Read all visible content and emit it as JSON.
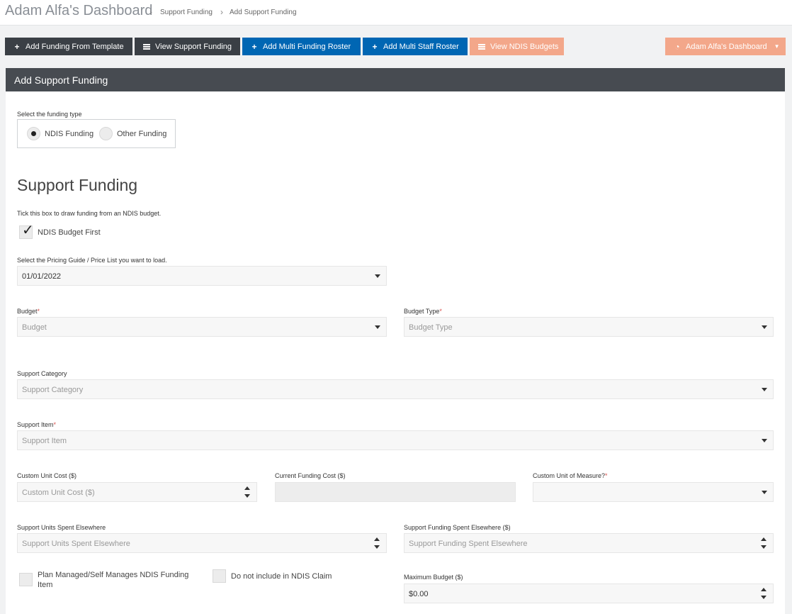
{
  "header": {
    "title": "Adam Alfa's Dashboard",
    "breadcrumbs": [
      "Support Funding",
      "Add Support Funding"
    ]
  },
  "toolbar": {
    "add_template": "Add Funding From Template",
    "view_support": "View Support Funding",
    "add_multi_funding": "Add Multi Funding Roster",
    "add_multi_staff": "Add Multi Staff Roster",
    "view_ndis": "View NDIS Budgets",
    "dashboard_menu": "Adam Alfa's Dashboard"
  },
  "panel": {
    "title": "Add Support Funding",
    "funding_type_label": "Select the funding type",
    "funding_types": [
      "NDIS Funding",
      "Other Funding"
    ],
    "selected_funding_type": "NDIS Funding"
  },
  "form": {
    "section_title": "Support Funding",
    "tick_hint": "Tick this box to draw funding from an NDIS budget.",
    "ndis_budget_first": {
      "label": "NDIS Budget First",
      "checked": true
    },
    "pricing_label": "Select the Pricing Guide / Price List you want to load.",
    "pricing_value": "01/01/2022",
    "budget_label": "Budget",
    "budget_placeholder": "Budget",
    "budget_type_label": "Budget Type",
    "budget_type_placeholder": "Budget Type",
    "support_category_label": "Support Category",
    "support_category_placeholder": "Support Category",
    "support_item_label": "Support Item",
    "support_item_placeholder": "Support Item",
    "custom_unit_cost_label": "Custom Unit Cost ($)",
    "custom_unit_cost_placeholder": "Custom Unit Cost ($)",
    "current_funding_cost_label": "Current Funding Cost ($)",
    "custom_uom_label": "Custom Unit of Measure?",
    "units_elsewhere_label": "Support Units Spent Elsewhere",
    "units_elsewhere_placeholder": "Support Units Spent Elsewhere",
    "funding_elsewhere_label": "Support Funding Spent Elsewhere ($)",
    "funding_elsewhere_placeholder": "Support Funding Spent Elsewhere",
    "plan_managed_label": "Plan Managed/Self Manages NDIS Funding Item",
    "not_include_label": "Do not include in NDIS Claim",
    "max_budget_label": "Maximum Budget ($)",
    "max_budget_value": "$0.00",
    "required_mark": "*"
  },
  "colors": {
    "dark_button": "#3a3f45",
    "blue_button": "#0066b3",
    "peach_button": "#f3a78a",
    "panel_header": "#474b51",
    "required": "#d9534f"
  }
}
